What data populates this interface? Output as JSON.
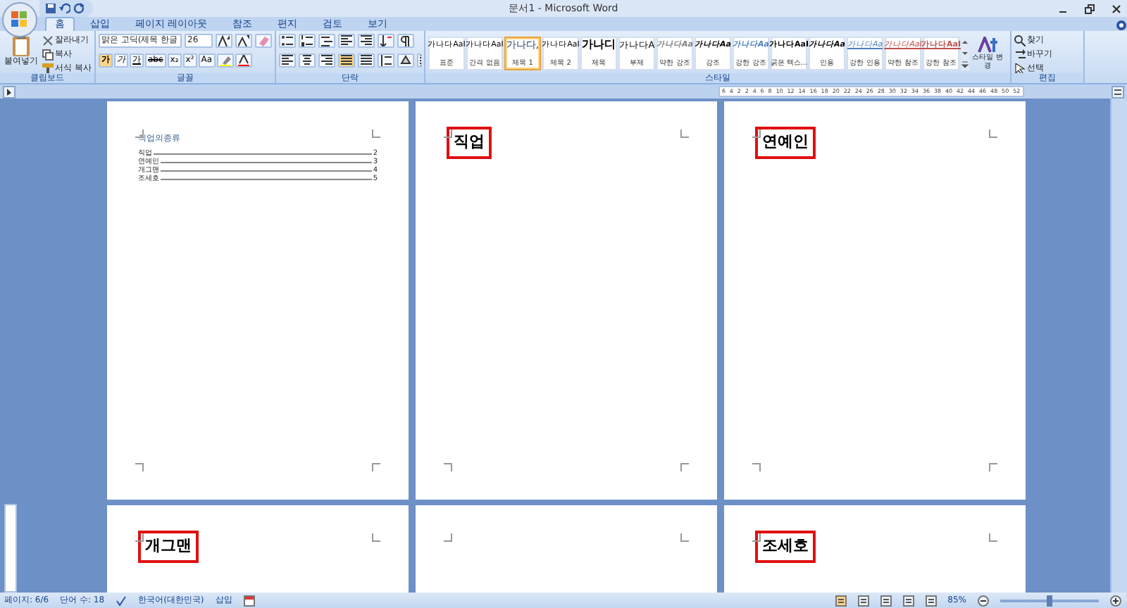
{
  "window": {
    "title": "문서1 - Microsoft Word"
  },
  "tabs": [
    {
      "label": "홈",
      "selected": true
    },
    {
      "label": "삽입",
      "selected": false
    },
    {
      "label": "페이지 레이아웃",
      "selected": false
    },
    {
      "label": "참조",
      "selected": false
    },
    {
      "label": "편지",
      "selected": false
    },
    {
      "label": "검토",
      "selected": false
    },
    {
      "label": "보기",
      "selected": false
    }
  ],
  "clipboard": {
    "paste": "붙여넣기",
    "items": [
      "잘라내기",
      "복사",
      "서식 복사"
    ],
    "group": "클립보드"
  },
  "font": {
    "face": "맑은 고딕(제목 한글",
    "size": "26",
    "format_buttons": [
      "가",
      "가",
      "가",
      "abc",
      "x₂",
      "x²",
      "Aa"
    ],
    "group": "글꼴"
  },
  "paragraph": {
    "group": "단락"
  },
  "styles": {
    "group": "스타일",
    "change": "스타일 변경",
    "items": [
      {
        "preview": "가나다AaI",
        "label": "표준",
        "kind": "plain",
        "color": "#000000",
        "selected": false
      },
      {
        "preview": "가나다AaI",
        "label": "간격 없음",
        "kind": "plain",
        "color": "#000000",
        "selected": false
      },
      {
        "preview": "가나다,",
        "label": "제목 1",
        "kind": "heading",
        "color": "#17365d",
        "selected": true
      },
      {
        "preview": "가나다AaI",
        "label": "제목 2",
        "kind": "plain",
        "color": "#000000",
        "selected": false
      },
      {
        "preview": "가나디",
        "label": "제목",
        "kind": "title",
        "color": "#000000",
        "selected": false
      },
      {
        "preview": "가나다A",
        "label": "부제",
        "kind": "subtitle",
        "color": "#000000",
        "selected": false
      },
      {
        "preview": "가나다Aa",
        "label": "약한 강조",
        "kind": "italic",
        "color": "#808080",
        "selected": false
      },
      {
        "preview": "가나다Aa",
        "label": "강조",
        "kind": "italic",
        "color": "#000000",
        "selected": false
      },
      {
        "preview": "가나다Aa",
        "label": "강한 강조",
        "kind": "italic",
        "color": "#4f81bd",
        "selected": false
      },
      {
        "preview": "가나다AaI",
        "label": "굵은 텍스...",
        "kind": "bold",
        "color": "#000000",
        "selected": false
      },
      {
        "preview": "가나다Aa",
        "label": "인용",
        "kind": "italic",
        "color": "#000000",
        "selected": false
      },
      {
        "preview": "가나다Aa",
        "label": "강한 인용",
        "kind": "underline",
        "color": "#4f81bd",
        "selected": false
      },
      {
        "preview": "가나다AaI",
        "label": "약한 참조",
        "kind": "underline",
        "color": "#c0504d",
        "selected": false
      },
      {
        "preview": "가나다AaI",
        "label": "강한 참조",
        "kind": "boldunderline",
        "color": "#c0504d",
        "selected": false
      }
    ]
  },
  "editing": {
    "group": "편집",
    "items": [
      "찾기",
      "바꾸기",
      "선택"
    ]
  },
  "ruler": [
    "6",
    "4",
    "2",
    "2",
    "4",
    "6",
    "8",
    "10",
    "12",
    "14",
    "16",
    "18",
    "20",
    "22",
    "24",
    "26",
    "28",
    "30",
    "32",
    "34",
    "36",
    "38",
    "40",
    "42",
    "44",
    "46",
    "48",
    "50",
    "52"
  ],
  "pages": [
    {
      "kind": "toc",
      "title": "직업의종류",
      "entries": [
        {
          "text": "직업",
          "page": "2"
        },
        {
          "text": "연예인",
          "page": "3"
        },
        {
          "text": "개그맨",
          "page": "4"
        },
        {
          "text": "조세호",
          "page": "5"
        }
      ]
    },
    {
      "kind": "heading",
      "heading": "직업"
    },
    {
      "kind": "heading",
      "heading": "연예인"
    },
    {
      "kind": "heading",
      "heading": "개그맨"
    },
    {
      "kind": "blank"
    },
    {
      "kind": "heading",
      "heading": "조세호"
    }
  ],
  "status_bar": {
    "items": [
      "페이지: 6/6",
      "단어 수: 18",
      "한국어(대한민국)",
      "삽입"
    ],
    "zoom": "85%",
    "zoom_slider": {
      "level": 0.5
    }
  }
}
